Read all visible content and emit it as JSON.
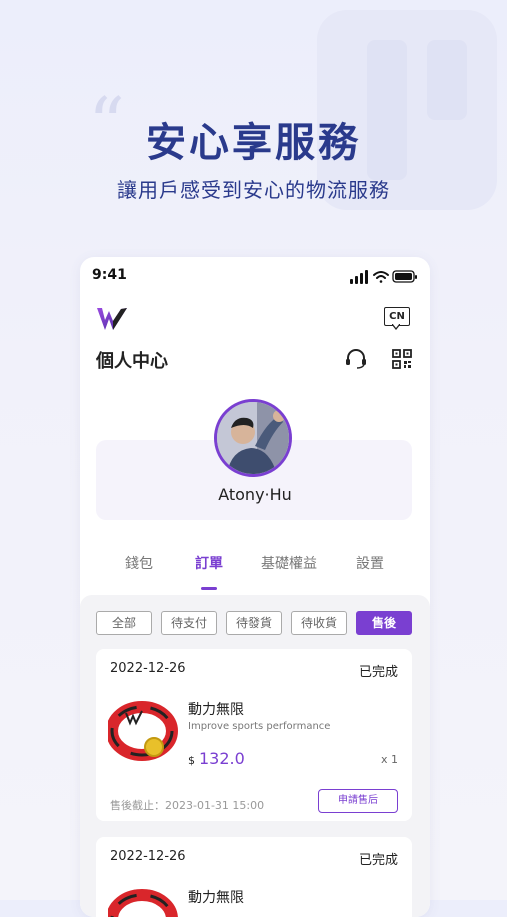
{
  "hero": {
    "quote_mark": "“",
    "title": "安心享服務",
    "subtitle": "讓用戶感受到安心的物流服務"
  },
  "status_bar": {
    "time": "9:41"
  },
  "header": {
    "lang_label": "CN",
    "page_title": "個人中心"
  },
  "profile": {
    "username": "Atony·Hu"
  },
  "tabs": [
    {
      "label": "錢包"
    },
    {
      "label": "訂單"
    },
    {
      "label": "基礎權益"
    },
    {
      "label": "設置"
    }
  ],
  "filters": [
    {
      "label": "全部"
    },
    {
      "label": "待支付"
    },
    {
      "label": "待發貨"
    },
    {
      "label": "待收貨"
    },
    {
      "label": "售後"
    }
  ],
  "active_filter": "售後",
  "orders": [
    {
      "date": "2022-12-26",
      "status": "已完成",
      "product_name": "動力無限",
      "product_desc": "Improve sports performance",
      "currency": "$",
      "price": "132.0",
      "qty": "x 1",
      "deadline": "售後截止：2023-01-31 15:00",
      "action": "申請售后"
    },
    {
      "date": "2022-12-26",
      "status": "已完成",
      "product_name": "動力無限"
    }
  ],
  "colors": {
    "accent": "#7a3fd1",
    "headline": "#2a3a8c",
    "background": "#eceefb"
  }
}
